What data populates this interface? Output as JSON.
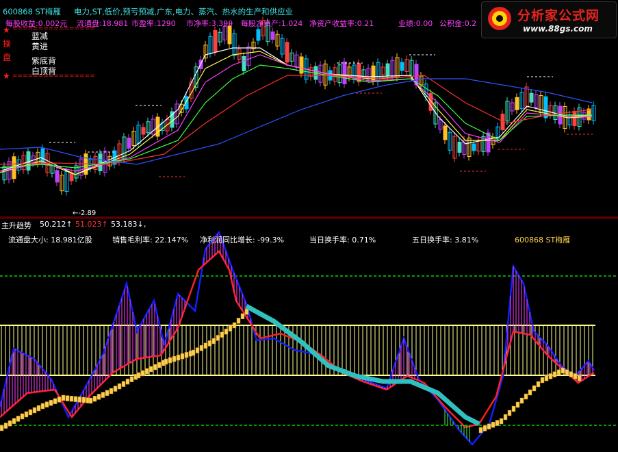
{
  "stock": {
    "code_name": "600868 ST梅雁",
    "sectors": "电力,ST,低价,预亏预减,广东,电力、蒸汽、热水的生产和供应业"
  },
  "info_line": {
    "eps": "每股收益:0.002元",
    "float_shares": "流通盘:18.981",
    "pe": "市盈率:1290",
    "pb": "市净率:3.399",
    "nav": "每股净资产:1.024",
    "roe": "净资产收益率:0.21",
    "performance": "业绩:0.00",
    "reserve": "公积金:0.2"
  },
  "legend": {
    "side_char_1": "操",
    "side_char_2": "盘",
    "stars": "★",
    "divider": "================",
    "items": [
      "蓝减",
      "黄进",
      "紫底背",
      "白顶背"
    ]
  },
  "price_annotation": "←-2.89",
  "indicator_bar": {
    "name": "主升趋势",
    "v1": "50.212↑",
    "v2": "51.023↑",
    "v3": "53.183↓",
    "tail": ","
  },
  "lower_info": {
    "float_size": "流通盘大小: 18.981亿股",
    "gross_margin": "销售毛利率: 22.147%",
    "profit_growth": "净利润同比增长: -99.3%",
    "turnover_today": "当日换手率: 0.71%",
    "turnover_5d": "五日换手率: 3.81%",
    "code_name": "600868 ST梅雁"
  },
  "logo": {
    "title": "分析家公式网",
    "url": "www.88gs.com"
  },
  "colors": {
    "red_text": "#ff3030",
    "cyan_text": "#40e0e0",
    "magenta_text": "#ff40ff",
    "yellow_text": "#ffff40",
    "white_text": "#ffffff",
    "band": "#ffff90"
  }
}
